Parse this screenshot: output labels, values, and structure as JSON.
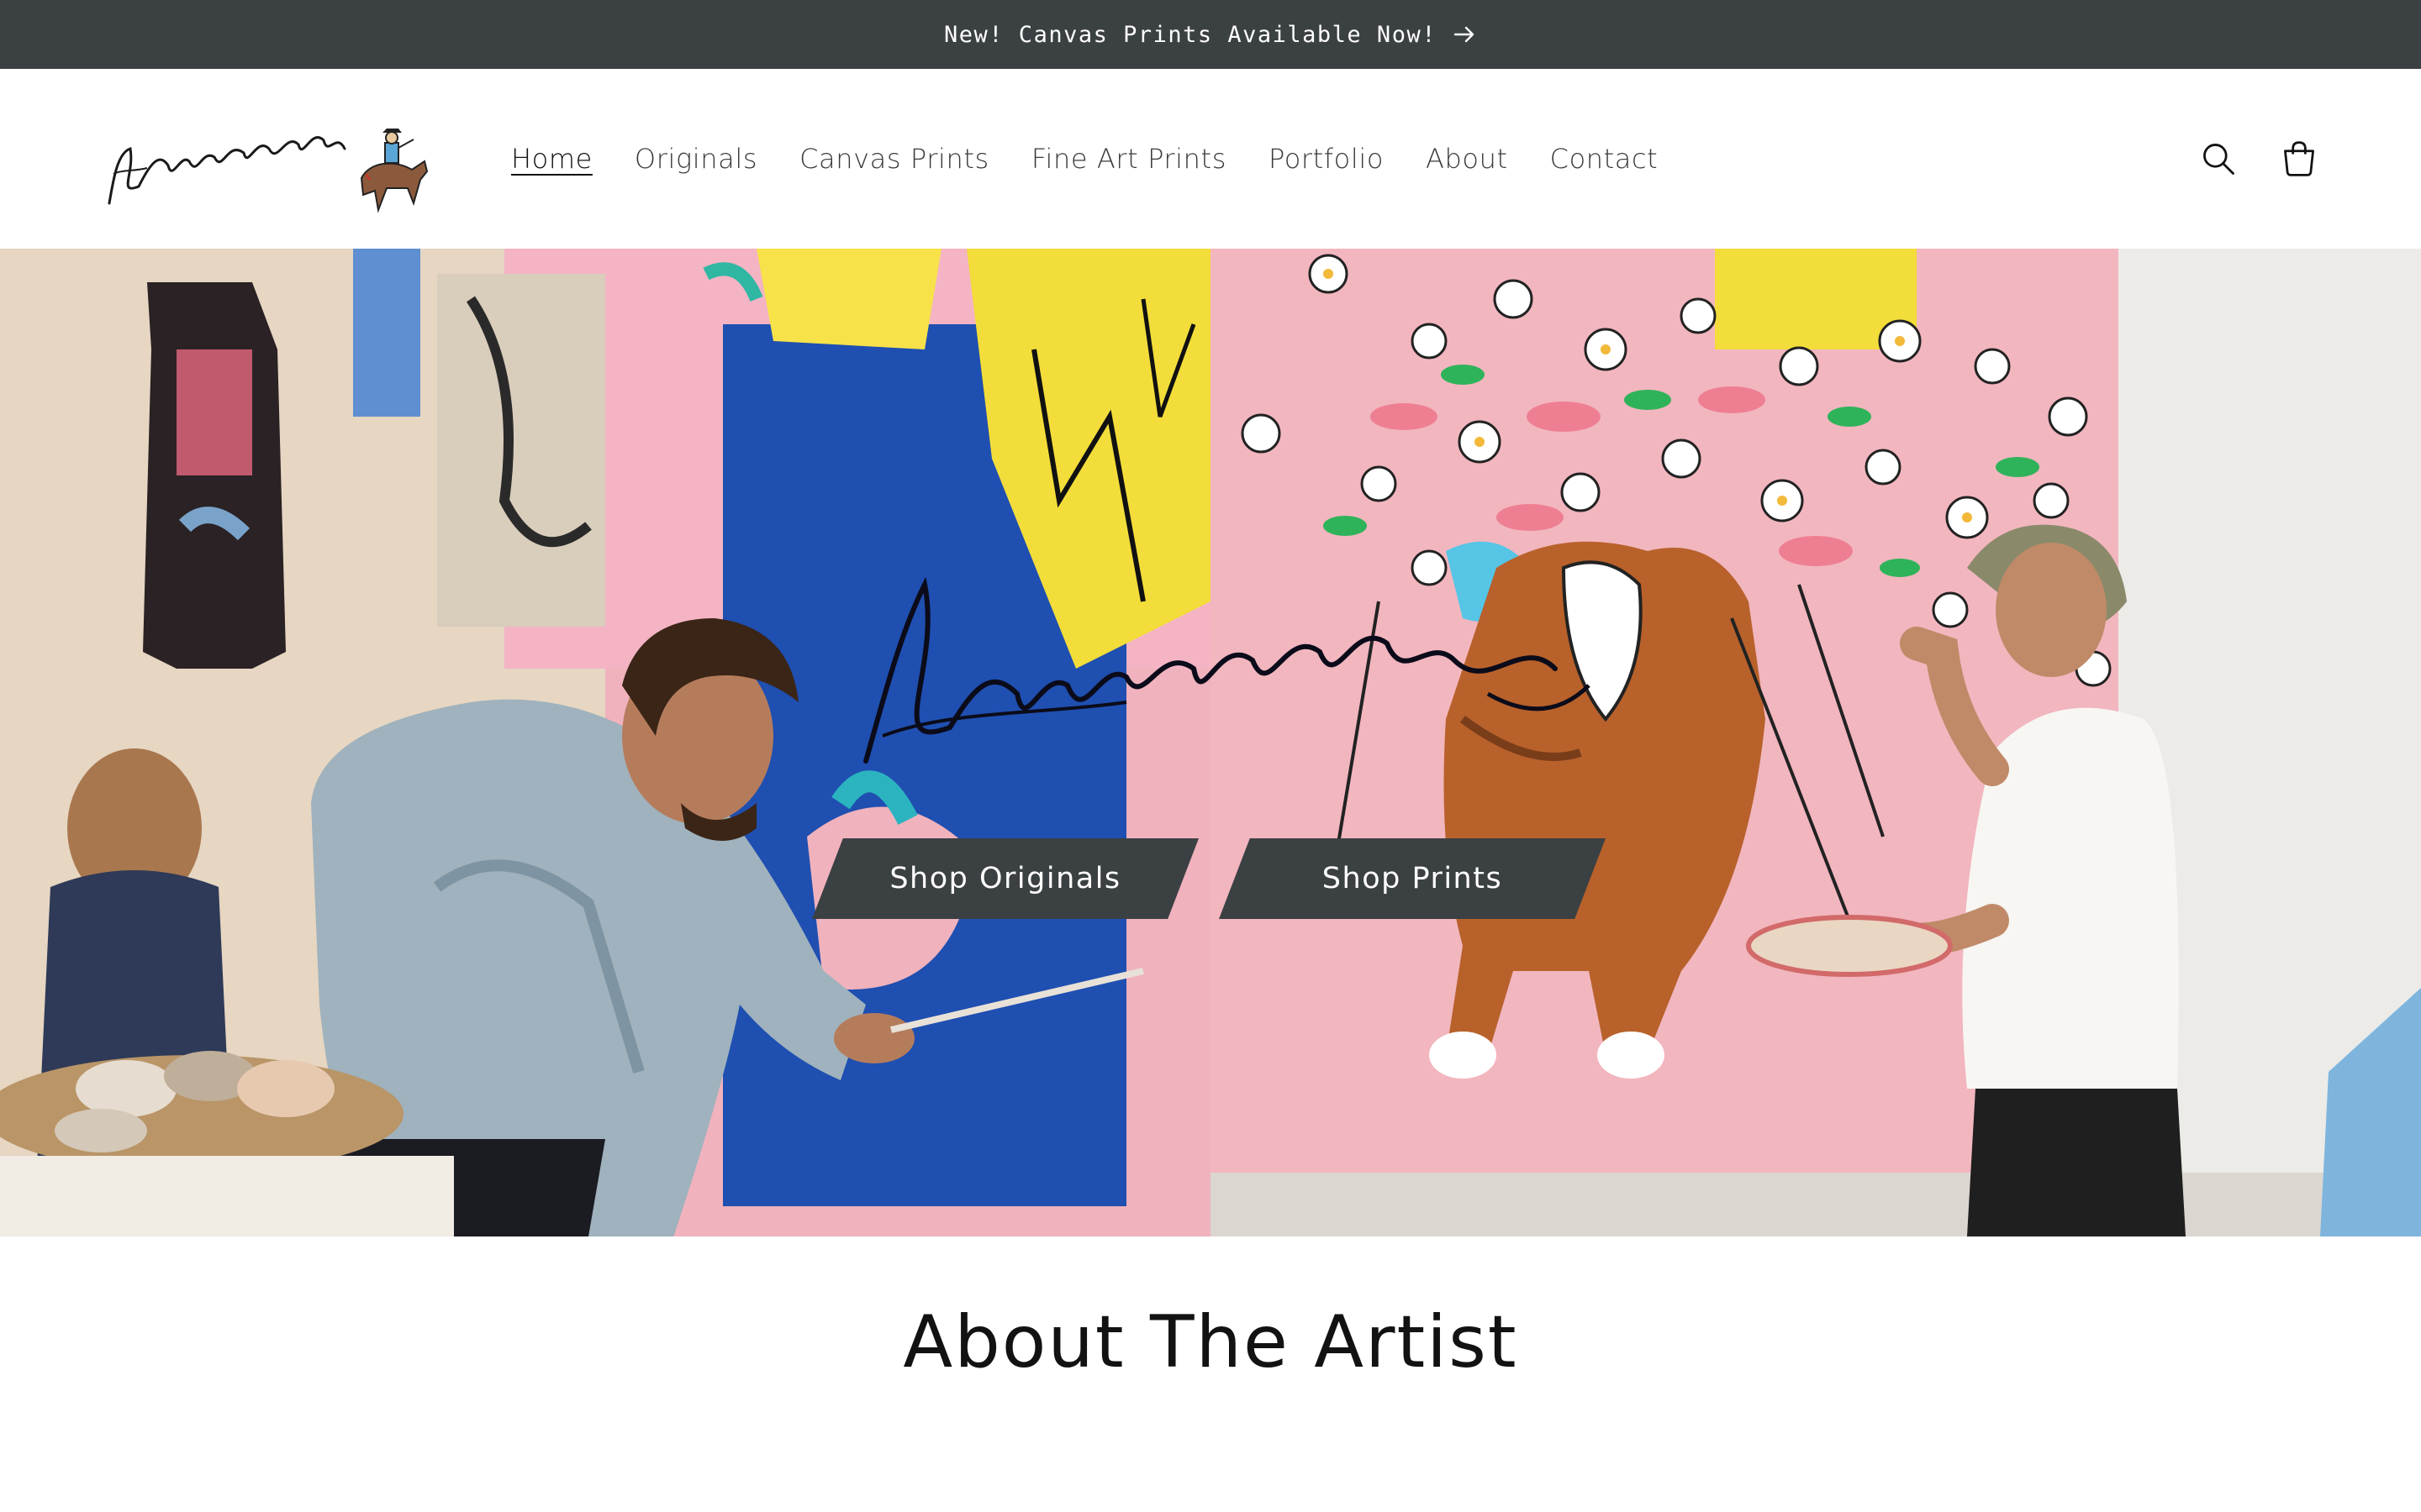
{
  "announcement": {
    "text": "New! Canvas Prints Available Now!",
    "arrow_icon": "arrow-right-icon"
  },
  "header": {
    "logo_text": "Jakempedro",
    "nav": [
      {
        "label": "Home",
        "active": true
      },
      {
        "label": "Originals",
        "active": false
      },
      {
        "label": "Canvas Prints",
        "active": false
      },
      {
        "label": "Fine Art Prints",
        "active": false
      },
      {
        "label": "Portfolio",
        "active": false
      },
      {
        "label": "About",
        "active": false
      },
      {
        "label": "Contact",
        "active": false
      }
    ],
    "icons": [
      "search-icon",
      "cart-icon"
    ]
  },
  "hero": {
    "signature_text": "Jakempedro",
    "cta_left": "Shop Originals",
    "cta_right": "Shop Prints"
  },
  "about": {
    "title": "About The Artist"
  },
  "colors": {
    "announcement_bg": "#3b4043",
    "button_bg": "#3b4043",
    "hero_pink": "#f0b2bd",
    "hero_blue": "#1f4fb0",
    "hero_yellow": "#f3dd3a"
  }
}
